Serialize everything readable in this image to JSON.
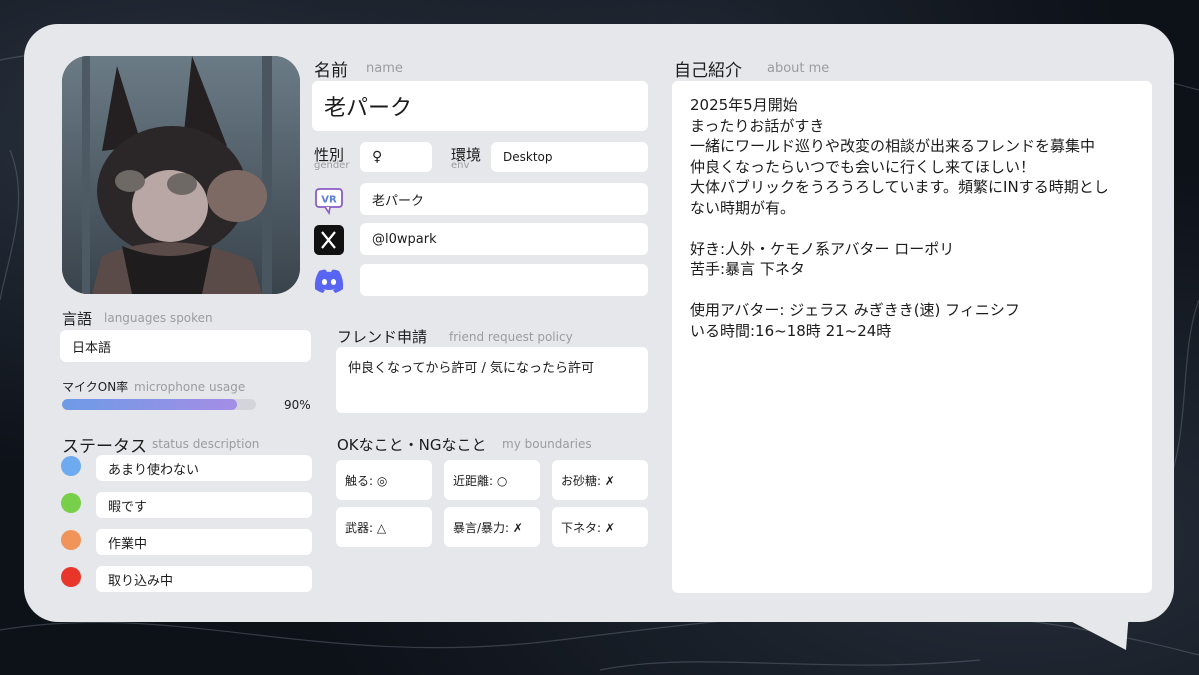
{
  "name": {
    "label": "名前",
    "sub": "name",
    "value": "老パーク"
  },
  "gender": {
    "label": "性別",
    "sub": "gender",
    "value": "♀"
  },
  "env": {
    "label": "環境",
    "sub": "env",
    "value": "Desktop"
  },
  "accounts": {
    "vrchat": "老パーク",
    "x": "@l0wpark",
    "discord": ""
  },
  "languages": {
    "label": "言語",
    "sub": "languages spoken",
    "value": "日本語"
  },
  "mic": {
    "label": "マイクON率",
    "sub": "microphone usage",
    "percent_text": "90%",
    "percent": 90
  },
  "status": {
    "label": "ステータス",
    "sub": "status description",
    "items": [
      {
        "color": "#6eaaf0",
        "text": "あまり使わない"
      },
      {
        "color": "#78d04a",
        "text": "暇です"
      },
      {
        "color": "#f0945a",
        "text": "作業中"
      },
      {
        "color": "#e8362a",
        "text": "取り込み中"
      }
    ]
  },
  "friend": {
    "label": "フレンド申請",
    "sub": "friend request policy",
    "value": "仲良くなってから許可 / 気になったら許可"
  },
  "boundaries": {
    "label": "OKなこと・NGなこと",
    "sub": "my boundaries",
    "items": [
      "触る: ◎",
      "近距離: ○",
      "お砂糖: ✗",
      "武器: △",
      "暴言/暴力: ✗",
      "下ネタ: ✗"
    ]
  },
  "about": {
    "label": "自己紹介",
    "sub": "about me",
    "lines": [
      "2025年5月開始",
      "まったりお話がすき",
      "一緒にワールド巡りや改変の相談が出来るフレンドを募集中",
      "仲良くなったらいつでも会いに行くし来てほしい！",
      "大体パブリックをうろうろしています。頻繁にINする時期とし",
      "ない時期が有。",
      "",
      "好き:人外・ケモノ系アバター ローポリ",
      "苦手:暴言 下ネタ",
      "",
      "使用アバター: ジェラス みぎきき(速) フィニシフ",
      "いる時間:16~18時 21~24時"
    ]
  },
  "colors": {
    "card": "#e6e7ea",
    "accent": "#5865f2",
    "mic_start": "#6d9be6",
    "mic_end": "#a58de6"
  }
}
